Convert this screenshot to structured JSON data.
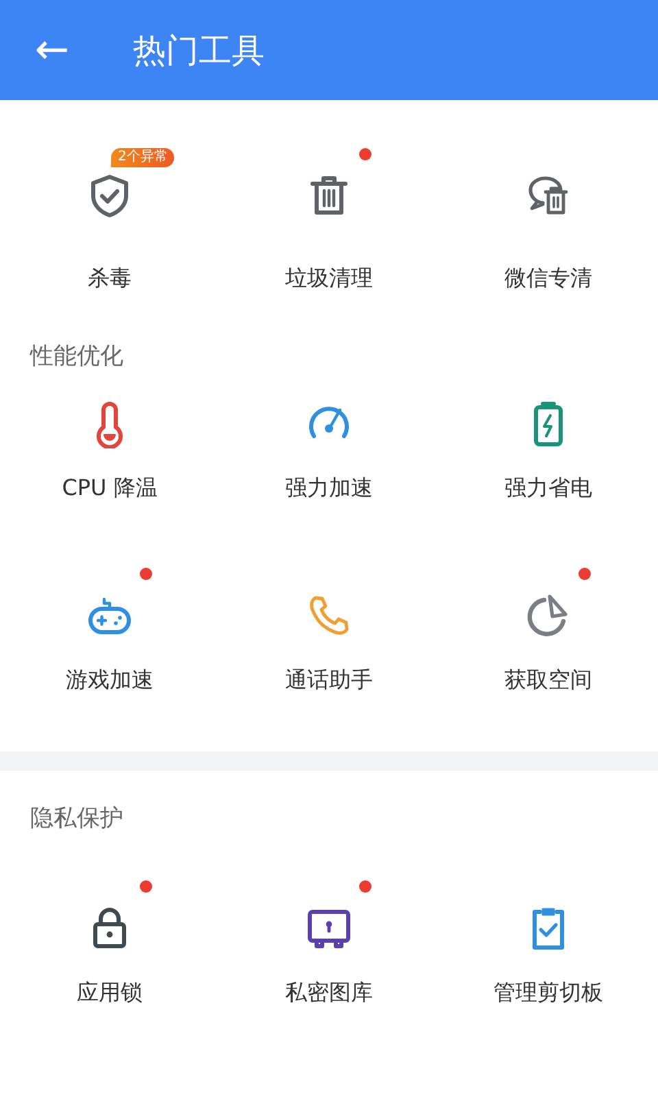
{
  "header": {
    "back": "←",
    "title": "热门工具"
  },
  "sections": [
    {
      "tools": [
        {
          "kind": "shield",
          "color": "#5f6368",
          "label": "杀毒",
          "dot": false,
          "badge": "2个异常"
        },
        {
          "kind": "trash",
          "color": "#5f6368",
          "label": "垃圾清理",
          "dot": true
        },
        {
          "kind": "chat-trash",
          "color": "#5f6368",
          "label": "微信专清",
          "dot": false
        }
      ]
    },
    {
      "title": "性能优化",
      "tools": [
        {
          "kind": "thermometer",
          "color": "#e2463b",
          "label": "CPU 降温",
          "dot": false
        },
        {
          "kind": "gauge",
          "color": "#2f8fe0",
          "label": "强力加速",
          "dot": false
        },
        {
          "kind": "battery",
          "color": "#1a9479",
          "label": "强力省电",
          "dot": false
        },
        {
          "kind": "gamepad",
          "color": "#2f8fe0",
          "label": "游戏加速",
          "dot": true
        },
        {
          "kind": "phone",
          "color": "#f0a032",
          "label": "通话助手",
          "dot": false
        },
        {
          "kind": "pie",
          "color": "#7b7e85",
          "label": "获取空间",
          "dot": true
        }
      ]
    },
    {
      "title": "隐私保护",
      "tools": [
        {
          "kind": "lock",
          "color": "#3f4a52",
          "label": "应用锁",
          "dot": true
        },
        {
          "kind": "safe",
          "color": "#5b3fb0",
          "label": "私密图库",
          "dot": true
        },
        {
          "kind": "clipboard",
          "color": "#2f8fe0",
          "label": "管理剪切板",
          "dot": false
        }
      ]
    }
  ]
}
